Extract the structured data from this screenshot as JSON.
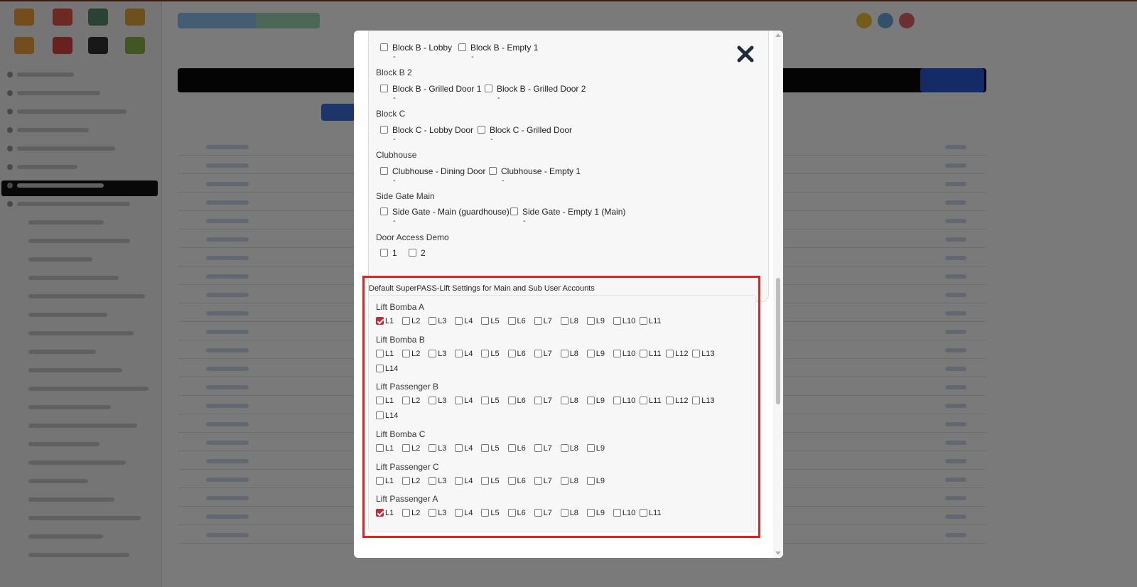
{
  "modal": {
    "door_groups": [
      {
        "title": "",
        "items": [
          {
            "label": "Block B - Lobby",
            "value": "-"
          },
          {
            "label": "Block B - Empty 1",
            "value": "-"
          }
        ]
      },
      {
        "title": "Block B 2",
        "items": [
          {
            "label": "Block B - Grilled Door 1",
            "value": "-"
          },
          {
            "label": "Block B - Grilled Door 2",
            "value": "-"
          }
        ]
      },
      {
        "title": "Block C",
        "items": [
          {
            "label": "Block C - Lobby Door",
            "value": "-"
          },
          {
            "label": "Block C - Grilled Door",
            "value": "-"
          }
        ]
      },
      {
        "title": "Clubhouse",
        "items": [
          {
            "label": "Clubhouse - Dining Door",
            "value": "-"
          },
          {
            "label": "Clubhouse - Empty 1",
            "value": "-"
          }
        ]
      },
      {
        "title": "Side Gate Main",
        "items": [
          {
            "label": "Side Gate - Main (guardhouse)",
            "value": "-"
          },
          {
            "label": "Side Gate - Empty 1 (Main)",
            "value": "-"
          }
        ]
      },
      {
        "title": "Door Access Demo",
        "items": [
          {
            "label": "1",
            "value": ""
          },
          {
            "label": "2",
            "value": ""
          }
        ]
      }
    ],
    "lift_section": {
      "heading": "Default SuperPASS-Lift Settings for Main and Sub User Accounts",
      "groups": [
        {
          "title": "Lift Bomba A",
          "levels": [
            "L1",
            "L2",
            "L3",
            "L4",
            "L5",
            "L6",
            "L7",
            "L8",
            "L9",
            "L10",
            "L11"
          ],
          "checked": [
            "L1"
          ]
        },
        {
          "title": "Lift Bomba B",
          "levels": [
            "L1",
            "L2",
            "L3",
            "L4",
            "L5",
            "L6",
            "L7",
            "L8",
            "L9",
            "L10",
            "L11",
            "L12",
            "L13",
            "L14"
          ],
          "checked": []
        },
        {
          "title": "Lift Passenger B",
          "levels": [
            "L1",
            "L2",
            "L3",
            "L4",
            "L5",
            "L6",
            "L7",
            "L8",
            "L9",
            "L10",
            "L11",
            "L12",
            "L13",
            "L14"
          ],
          "checked": []
        },
        {
          "title": "Lift Bomba C",
          "levels": [
            "L1",
            "L2",
            "L3",
            "L4",
            "L5",
            "L6",
            "L7",
            "L8",
            "L9"
          ],
          "checked": []
        },
        {
          "title": "Lift Passenger C",
          "levels": [
            "L1",
            "L2",
            "L3",
            "L4",
            "L5",
            "L6",
            "L7",
            "L8",
            "L9"
          ],
          "checked": []
        },
        {
          "title": "Lift Passenger A",
          "levels": [
            "L1",
            "L2",
            "L3",
            "L4",
            "L5",
            "L6",
            "L7",
            "L8",
            "L9",
            "L10",
            "L11"
          ],
          "checked": [
            "L1"
          ]
        }
      ]
    },
    "close_icon": "close-x-icon",
    "colors": {
      "checked": "#d42230",
      "highlight_border": "#e02424"
    }
  }
}
